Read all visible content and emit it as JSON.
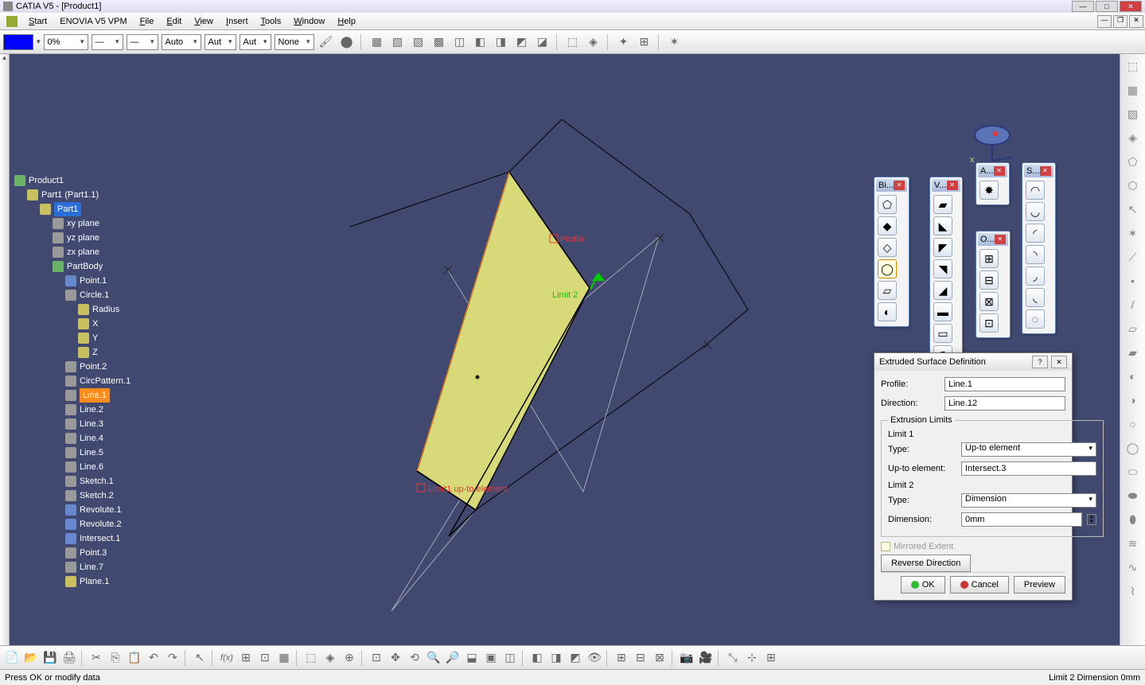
{
  "app": {
    "title": "CATIA V5 - [Product1]"
  },
  "menu": {
    "start": "Start",
    "enovia": "ENOVIA V5 VPM",
    "file": "File",
    "edit": "Edit",
    "view": "View",
    "insert": "Insert",
    "tools": "Tools",
    "window": "Window",
    "help": "Help"
  },
  "toolbar": {
    "opacity": "0%",
    "auto1": "Auto",
    "auto2": "Aut",
    "auto3": "Aut",
    "none": "None"
  },
  "tree": {
    "root": "Product1",
    "part_inst": "Part1 (Part1.1)",
    "part": "Part1",
    "xy": "xy plane",
    "yz": "yz plane",
    "zx": "zx plane",
    "partbody": "PartBody",
    "point1": "Point.1",
    "circle1": "Circle.1",
    "radius": "Radius",
    "x": "X",
    "y": "Y",
    "z": "Z",
    "point2": "Point.2",
    "circpattern": "CircPattern.1",
    "line1": "Line.1",
    "line2": "Line.2",
    "line3": "Line.3",
    "line4": "Line.4",
    "line5": "Line.5",
    "line6": "Line.6",
    "sketch1": "Sketch.1",
    "sketch2": "Sketch.2",
    "revolute1": "Revolute.1",
    "revolute2": "Revolute.2",
    "intersect1": "Intersect.1",
    "point3": "Point.3",
    "line7": "Line.7",
    "plane1": "Plane.1"
  },
  "annotations": {
    "profile": "Profile",
    "limit2": "Limit 2",
    "limit1": "Limit1 up-to element"
  },
  "floats": {
    "bi": "Bi...",
    "v": "V...",
    "a": "A...",
    "o": "O...",
    "s": "S..."
  },
  "dialog": {
    "title": "Extruded Surface Definition",
    "profile_lbl": "Profile:",
    "profile_val": "Line.1",
    "direction_lbl": "Direction:",
    "direction_val": "Line.12",
    "limits_legend": "Extrusion Limits",
    "limit1_lbl": "Limit 1",
    "type_lbl": "Type:",
    "type1_val": "Up-to element",
    "upto_lbl": "Up-to element:",
    "upto_val": "Intersect.3",
    "limit2_lbl": "Limit 2",
    "type2_val": "Dimension",
    "dimension_lbl": "Dimension:",
    "dimension_val": "0mm",
    "mirrored": "Mirrored Extent",
    "reverse": "Reverse Direction",
    "ok": "OK",
    "cancel": "Cancel",
    "preview": "Preview"
  },
  "status": {
    "left": "Press OK or modify data",
    "right": "Limit 2 Dimension   0mm"
  }
}
